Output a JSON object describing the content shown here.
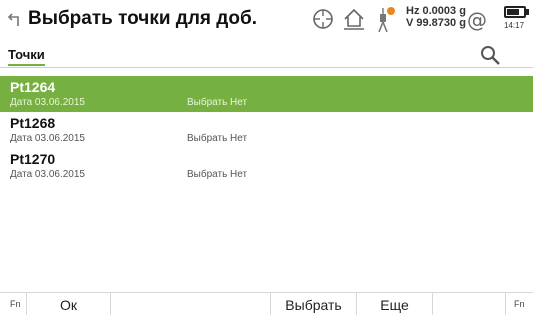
{
  "header": {
    "title": "Выбрать точки для доб.",
    "hz_readout": "Hz 0.0003 g",
    "v_readout": "V   99.8730 g",
    "at_symbol": "@",
    "time": "14:17",
    "battery_level": 0.75,
    "icons": [
      "back-icon",
      "target-icon",
      "home-icon",
      "prism-icon",
      "battery-icon"
    ]
  },
  "tabs": {
    "active_label": "Точки"
  },
  "points": [
    {
      "name": "Pt1264",
      "date": "Дата  03.06.2015",
      "select": "Выбрать  Нет",
      "selected": true
    },
    {
      "name": "Pt1268",
      "date": "Дата  03.06.2015",
      "select": "Выбрать  Нет",
      "selected": false
    },
    {
      "name": "Pt1270",
      "date": "Дата  03.06.2015",
      "select": "Выбрать  Нет",
      "selected": false
    }
  ],
  "softkeys": {
    "fn_left": "Fn",
    "f1": "Ок",
    "f2": "",
    "f3": "Выбрать",
    "f4": "Еще",
    "f5": "",
    "fn_right": "Fn"
  },
  "colors": {
    "accent": "#76b041"
  }
}
